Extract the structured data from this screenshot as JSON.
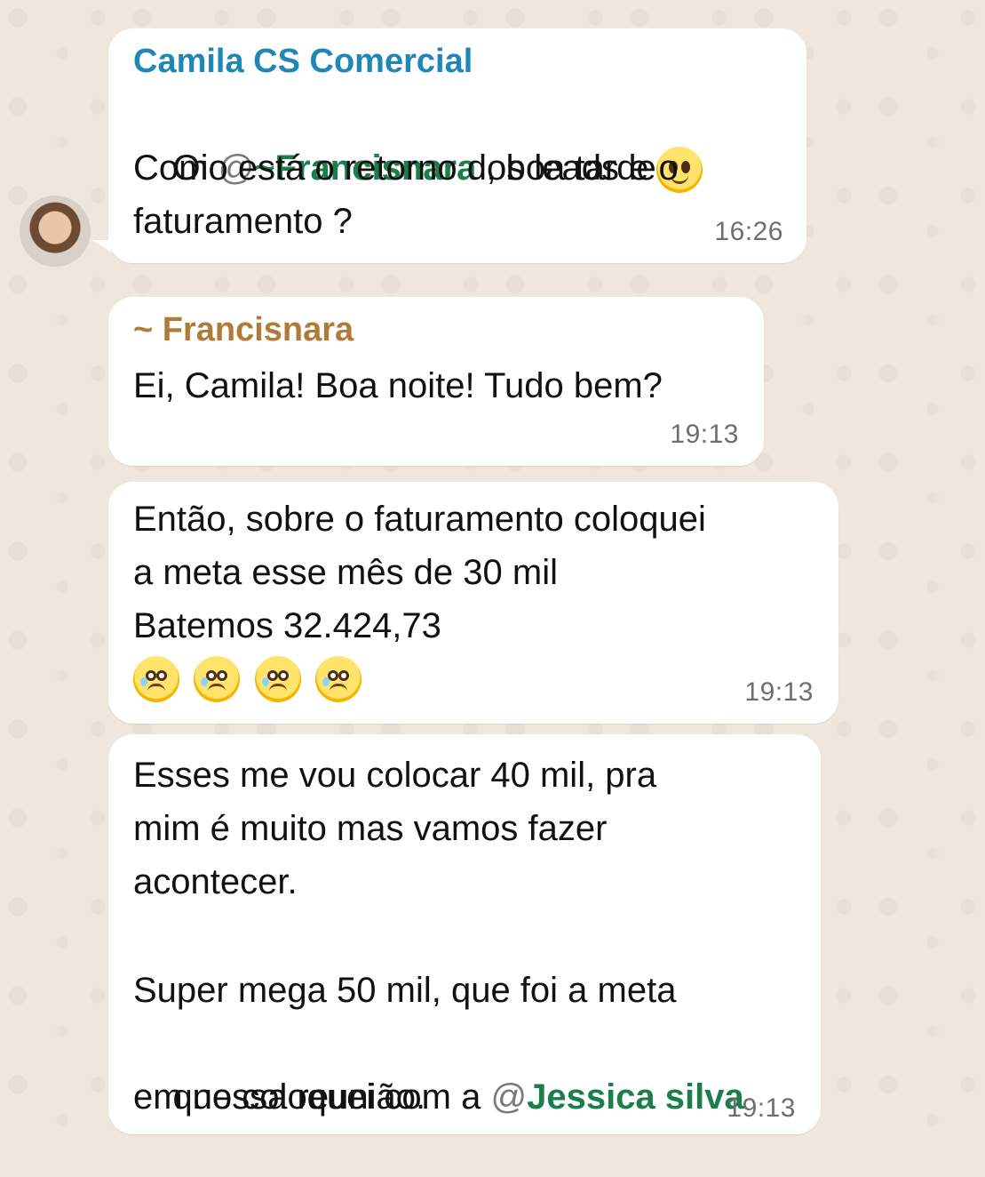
{
  "chat": {
    "messages": [
      {
        "sender": "Camila CS Comercial",
        "line1_prefix": "Oi ",
        "mention_at": "@",
        "mention_name": "~Francisnara",
        "line1_suffix": " , boa tarde",
        "line2": "Como está o retorno dos leads e o",
        "line3": "faturamento ?",
        "time": "16:26",
        "emoji": "grinning-face"
      },
      {
        "sender": "~ Francisnara",
        "text": "Ei, Camila! Boa noite! Tudo bem?",
        "time": "19:13"
      },
      {
        "line1": "Então, sobre o faturamento coloquei",
        "line2": "a meta esse mês de 30 mil",
        "line3": "Batemos 32.424,73",
        "time": "19:13",
        "emoji_count": 4,
        "emoji": "pleading-face"
      },
      {
        "line1": "Esses me vou colocar 40 mil, pra",
        "line2": "mim é muito mas vamos fazer",
        "line3": "acontecer.",
        "line4": "Super mega 50 mil, que foi a meta",
        "line5_prefix": "que coloquei com a ",
        "mention_at": "@",
        "mention_name": "Jessica silva",
        "line6": "em nossa reunião.",
        "time": "19:13"
      }
    ]
  },
  "colors": {
    "background": "#efe7dd",
    "bubble": "#ffffff",
    "camila_name": "#1f87b8",
    "francisnara_name": "#b07b38",
    "mention_green": "#1a7f4b",
    "mention_at": "#7a7a7a",
    "time": "#6e6e6e",
    "text": "#111111"
  }
}
